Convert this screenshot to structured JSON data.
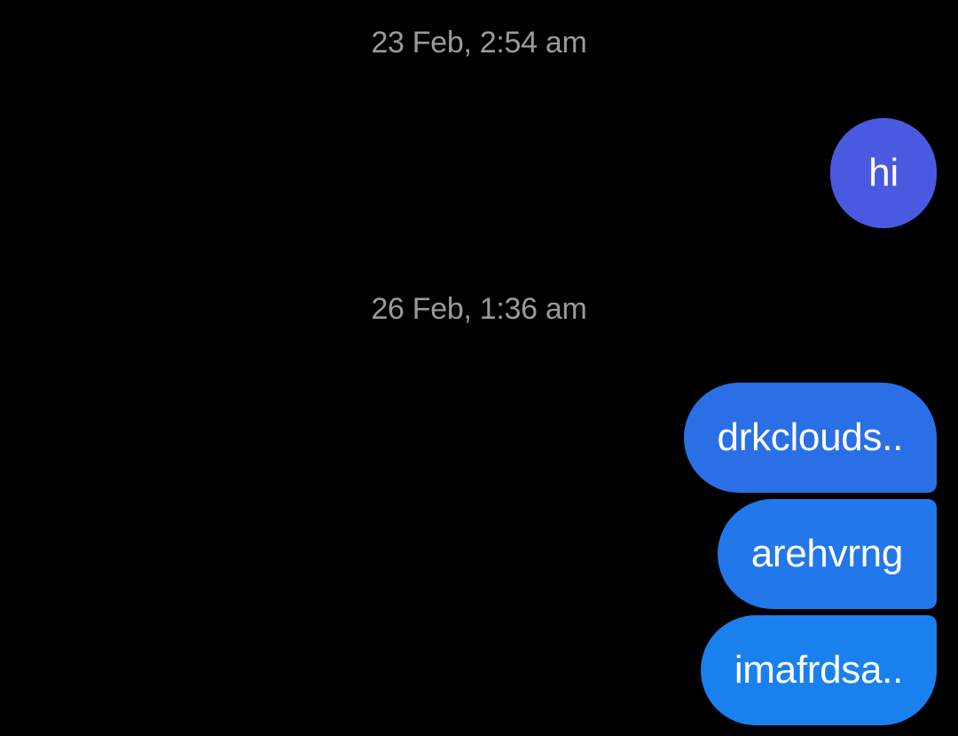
{
  "conversation": {
    "groups": [
      {
        "timestamp": "23 Feb, 2:54 am",
        "messages": [
          {
            "text": "hi",
            "color": "#4a5ae0"
          }
        ]
      },
      {
        "timestamp": "26 Feb, 1:36 am",
        "messages": [
          {
            "text": "drkclouds..",
            "color": "#2b6fe6"
          },
          {
            "text": "arehvrng",
            "color": "#2277ea"
          },
          {
            "text": "imafrdsa..",
            "color": "#1a80ee"
          }
        ]
      }
    ]
  },
  "colors": {
    "background": "#000000",
    "timestamp_text": "#9a9a9a",
    "bubble_text": "#ffffff"
  }
}
